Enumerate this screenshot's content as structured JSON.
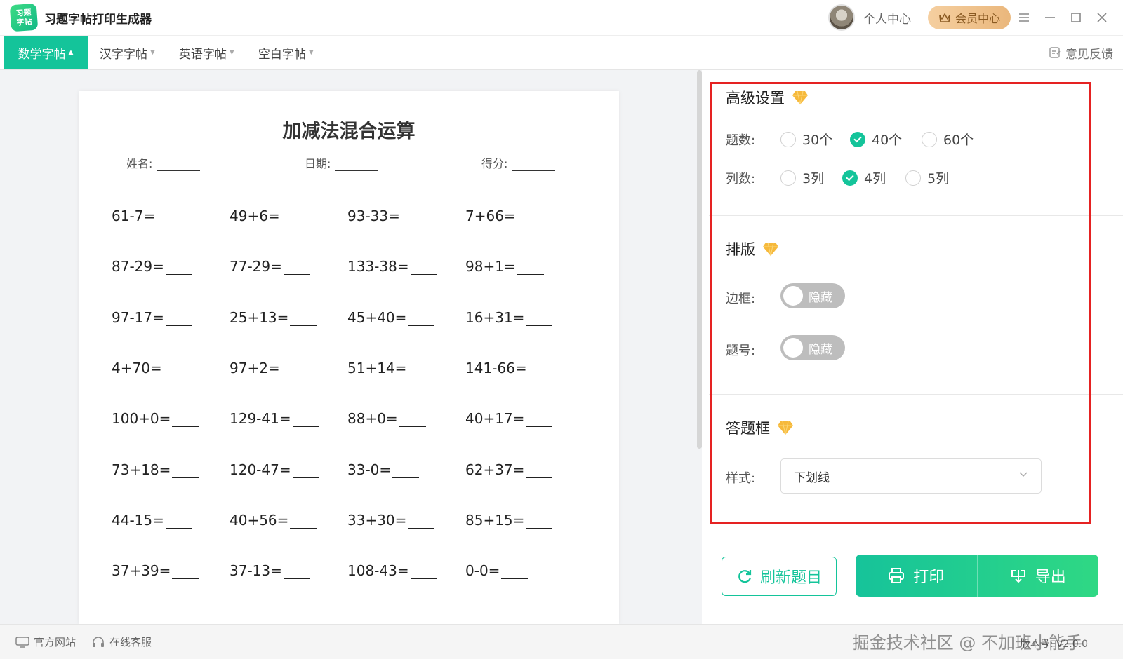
{
  "app": {
    "logo_line1": "习题",
    "logo_line2": "字帖",
    "title": "习题字帖打印生成器",
    "personal_center": "个人中心",
    "vip_center": "会员中心"
  },
  "nav": {
    "tabs": [
      {
        "label": "数学字帖",
        "active": true
      },
      {
        "label": "汉字字帖",
        "active": false
      },
      {
        "label": "英语字帖",
        "active": false
      },
      {
        "label": "空白字帖",
        "active": false
      }
    ],
    "feedback": "意见反馈"
  },
  "worksheet": {
    "title": "加减法混合运算",
    "name_label": "姓名:",
    "date_label": "日期:",
    "score_label": "得分:",
    "problems": [
      [
        "61-7=",
        "49+6=",
        "93-33=",
        "7+66="
      ],
      [
        "87-29=",
        "77-29=",
        "133-38=",
        "98+1="
      ],
      [
        "97-17=",
        "25+13=",
        "45+40=",
        "16+31="
      ],
      [
        "4+70=",
        "97+2=",
        "51+14=",
        "141-66="
      ],
      [
        "100+0=",
        "129-41=",
        "88+0=",
        "40+17="
      ],
      [
        "73+18=",
        "120-47=",
        "33-0=",
        "62+37="
      ],
      [
        "44-15=",
        "40+56=",
        "33+30=",
        "85+15="
      ],
      [
        "37+39=",
        "37-13=",
        "108-43=",
        "0-0="
      ]
    ]
  },
  "settings": {
    "advanced": {
      "title": "高级设置",
      "count_label": "题数:",
      "count_options": [
        {
          "label": "30个",
          "checked": false
        },
        {
          "label": "40个",
          "checked": true
        },
        {
          "label": "60个",
          "checked": false
        }
      ],
      "columns_label": "列数:",
      "column_options": [
        {
          "label": "3列",
          "checked": false
        },
        {
          "label": "4列",
          "checked": true
        },
        {
          "label": "5列",
          "checked": false
        }
      ]
    },
    "layout": {
      "title": "排版",
      "border_label": "边框:",
      "border_toggle": "隐藏",
      "number_label": "题号:",
      "number_toggle": "隐藏"
    },
    "answer_box": {
      "title": "答题框",
      "style_label": "样式:",
      "style_value": "下划线"
    },
    "refresh_button": "刷新题目",
    "print_button": "打印",
    "export_button": "导出"
  },
  "footer": {
    "website": "官方网站",
    "support": "在线客服",
    "version": "版本号: V2.0.0",
    "watermark": "掘金技术社区 @ 不加班小能手"
  },
  "colors": {
    "accent": "#14c49a",
    "highlight_box": "#e52222",
    "gem": "#f6b93b"
  }
}
